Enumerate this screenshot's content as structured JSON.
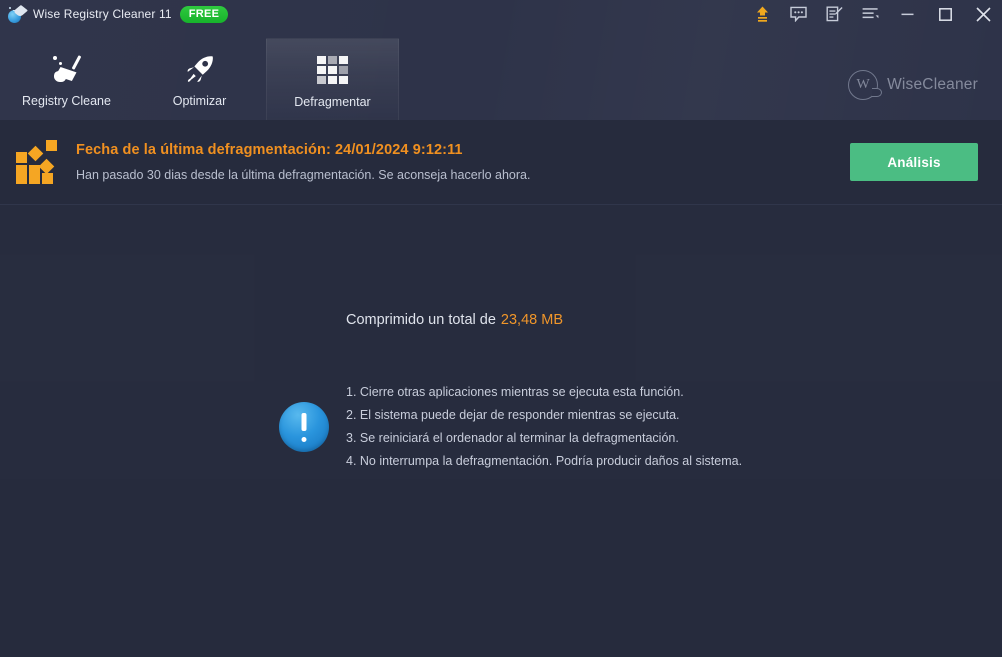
{
  "window": {
    "app_title": "Wise Registry Cleaner 11",
    "free_badge": "FREE",
    "logo_icon": "broom-bubble-icon",
    "controls": {
      "upgrade": "upgrade-arrow-icon",
      "feedback": "feedback-chat-icon",
      "register": "edit-note-icon",
      "menu": "menu-list-icon",
      "minimize": "minimize-icon",
      "maximize": "maximize-icon",
      "close": "close-icon"
    }
  },
  "nav": {
    "tabs": [
      {
        "label": "Registry Cleane",
        "icon": "broom-icon",
        "active": false
      },
      {
        "label": "Optimizar",
        "icon": "rocket-icon",
        "active": false
      },
      {
        "label": "Defragmentar",
        "icon": "grid-blocks-icon",
        "active": true
      }
    ]
  },
  "brand": {
    "mark": "W",
    "name": "WiseCleaner"
  },
  "banner": {
    "icon": "defrag-blocks-icon",
    "title": "Fecha de la última defragmentación: 24/01/2024 9:12:11",
    "subtitle": "Han pasado 30 dias desde la última defragmentación. Se aconseja hacerlo ahora.",
    "action_label": "Análisis"
  },
  "main": {
    "total_prefix": "Comprimido un total de",
    "total_value": "23,48 MB",
    "notice_icon": "info-exclamation-icon",
    "notices": [
      "1. Cierre otras aplicaciones mientras se ejecuta esta función.",
      "2. El sistema puede dejar de responder mientras se ejecuta.",
      "3. Se reiniciará el ordenador al terminar la defragmentación.",
      "4. No interrumpa la defragmentación. Podría producir daños al sistema."
    ]
  },
  "colors": {
    "header_bg": "#2e3349",
    "body_bg": "#262b3d",
    "accent_orange": "#f09020",
    "accent_green": "#4bbd83",
    "badge_green": "#22bb33",
    "info_blue": "#2a95dd",
    "text_primary": "#dfe3ec",
    "text_secondary": "#b9bfcf"
  }
}
